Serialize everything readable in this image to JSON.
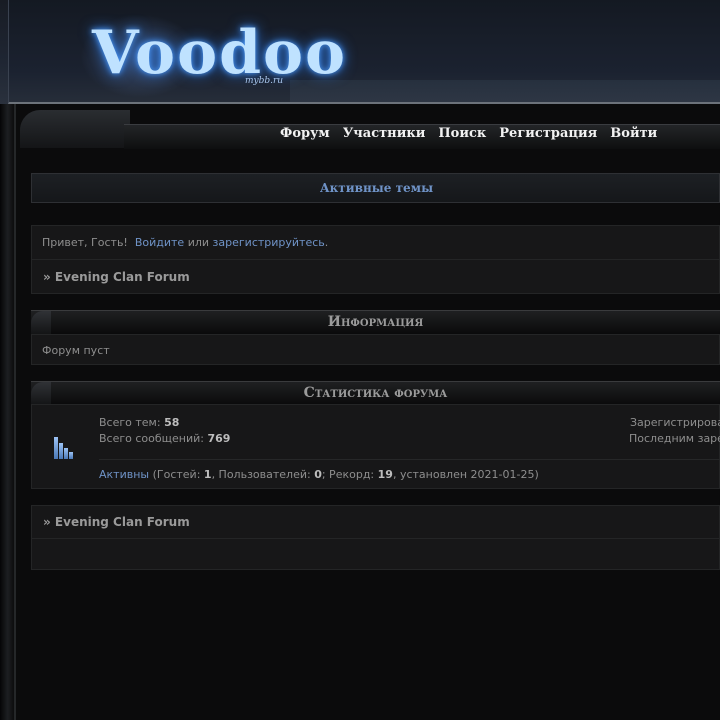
{
  "logo": {
    "text": "Voodoo",
    "sub": "mybb.ru"
  },
  "nav": {
    "items": [
      {
        "label": "Форум"
      },
      {
        "label": "Участники"
      },
      {
        "label": "Поиск"
      },
      {
        "label": "Регистрация"
      },
      {
        "label": "Войти"
      }
    ]
  },
  "active_topics": {
    "label": "Активные темы"
  },
  "welcome": {
    "greeting": "Привет, Гость!",
    "login_link": "Войдите",
    "or": "или",
    "register_link": "зарегистрируйтесь",
    "period": "."
  },
  "breadcrumb": {
    "text": "» Evening Clan Forum"
  },
  "info_section": {
    "title": "Информация",
    "body": "Форум пуст"
  },
  "stats_section": {
    "title": "Статистика форума",
    "topics_label": "Всего тем:",
    "topics_value": "58",
    "posts_label": "Всего сообщений:",
    "posts_value": "769",
    "registered_label": "Зарегистрирова",
    "last_registered_label": "Последним заре",
    "active_link": "Активны",
    "active_pre": "(Гостей:",
    "guests": "1",
    "users_label": ", Пользователей:",
    "users": "0",
    "record_label": "; Рекорд:",
    "record": "19",
    "record_date": ", установлен 2021-01-25)"
  },
  "footer_breadcrumb": {
    "text": "» Evening Clan Forum"
  }
}
